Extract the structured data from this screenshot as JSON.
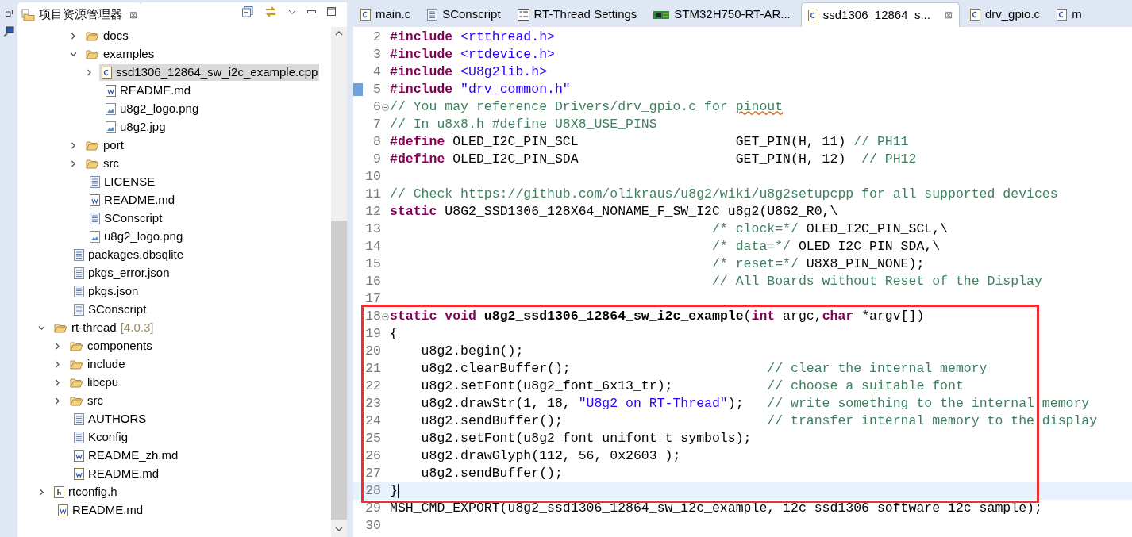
{
  "explorer": {
    "title": "项目资源管理器",
    "close": "⊠",
    "tree": [
      {
        "children": [
          {
            "children": [
              {
                "label": "docs",
                "kind": "folder",
                "expanded": false,
                "selected": false
              },
              {
                "label": "examples",
                "kind": "folder",
                "expanded": true,
                "selected": false,
                "children": [
                  {
                    "label": "ssd1306_12864_sw_i2c_example.cpp",
                    "kind": "c",
                    "expanded": false,
                    "selected": true
                  },
                  {
                    "label": "README.md",
                    "kind": "md",
                    "selected": false
                  },
                  {
                    "label": "u8g2_logo.png",
                    "kind": "image",
                    "selected": false
                  },
                  {
                    "label": "u8g2.jpg",
                    "kind": "image",
                    "selected": false
                  }
                ]
              },
              {
                "label": "port",
                "kind": "folder",
                "expanded": false,
                "selected": false
              },
              {
                "label": "src",
                "kind": "folder",
                "expanded": false,
                "selected": false
              },
              {
                "label": "LICENSE",
                "kind": "text",
                "selected": false
              },
              {
                "label": "README.md",
                "kind": "md",
                "selected": false
              },
              {
                "label": "SConscript",
                "kind": "text",
                "selected": false
              },
              {
                "label": "u8g2_logo.png",
                "kind": "image",
                "selected": false
              }
            ]
          },
          {
            "label": "packages.dbsqlite",
            "kind": "text",
            "selected": false
          },
          {
            "label": "pkgs_error.json",
            "kind": "text",
            "selected": false
          },
          {
            "label": "pkgs.json",
            "kind": "text",
            "selected": false
          },
          {
            "label": "SConscript",
            "kind": "text",
            "selected": false
          }
        ]
      },
      {
        "label": "rt-thread",
        "suffix": "[4.0.3]",
        "kind": "folder",
        "expanded": true,
        "selected": false,
        "children": [
          {
            "label": "components",
            "kind": "folder",
            "expanded": false,
            "selected": false
          },
          {
            "label": "include",
            "kind": "folder",
            "expanded": false,
            "selected": false
          },
          {
            "label": "libcpu",
            "kind": "folder",
            "expanded": false,
            "selected": false
          },
          {
            "label": "src",
            "kind": "folder",
            "expanded": false,
            "selected": false
          },
          {
            "label": "AUTHORS",
            "kind": "text",
            "selected": false
          },
          {
            "label": "Kconfig",
            "kind": "text",
            "selected": false
          },
          {
            "label": "README_zh.md",
            "kind": "md",
            "selected": false
          },
          {
            "label": "README.md",
            "kind": "md",
            "selected": false
          }
        ]
      },
      {
        "label": "rtconfig.h",
        "kind": "h",
        "expanded": false,
        "selected": false
      },
      {
        "label": "README.md",
        "kind": "md",
        "selected": false
      }
    ]
  },
  "editor": {
    "tabs": [
      {
        "label": "main.c",
        "kind": "c",
        "selected": false
      },
      {
        "label": "SConscript",
        "kind": "text",
        "selected": false
      },
      {
        "label": "RT-Thread Settings",
        "kind": "settings",
        "selected": false
      },
      {
        "label": "STM32H750-RT-AR...",
        "kind": "board",
        "selected": false
      },
      {
        "label": "ssd1306_12864_s...",
        "kind": "c",
        "selected": true,
        "close": "⊠"
      },
      {
        "label": "drv_gpio.c",
        "kind": "c",
        "selected": false
      },
      {
        "label": "m",
        "kind": "c",
        "selected": false
      }
    ],
    "blocks": [
      {
        "boxed": false,
        "lines": [
          {
            "n": "2",
            "fold": false,
            "marker": false,
            "current": false,
            "t": [
              {
                "kind": "kw",
                "text": "#include"
              },
              {
                "kind": "hdr",
                "text": " <rtthread.h>"
              }
            ]
          },
          {
            "n": "3",
            "fold": false,
            "marker": false,
            "current": false,
            "t": [
              {
                "kind": "kw",
                "text": "#include"
              },
              {
                "kind": "hdr",
                "text": " <rtdevice.h>"
              }
            ]
          },
          {
            "n": "4",
            "fold": false,
            "marker": false,
            "current": false,
            "t": [
              {
                "kind": "kw",
                "text": "#include"
              },
              {
                "kind": "hdr",
                "text": " <U8g2lib.h>"
              }
            ]
          },
          {
            "n": "5",
            "fold": false,
            "marker": true,
            "current": false,
            "t": [
              {
                "kind": "kw",
                "text": "#include"
              },
              {
                "kind": "hdr",
                "text": " \"drv_common.h\""
              }
            ]
          },
          {
            "n": "6",
            "fold": true,
            "marker": false,
            "current": false,
            "t": [
              {
                "kind": "cm",
                "text": "// You may reference Drivers/drv_gpio.c for "
              },
              {
                "kind": "cmw",
                "text": "pinout"
              }
            ]
          },
          {
            "n": "7",
            "fold": false,
            "marker": false,
            "current": false,
            "t": [
              {
                "kind": "cm",
                "text": "// In u8x8.h #define U8X8_USE_PINS"
              }
            ]
          },
          {
            "n": "8",
            "fold": false,
            "marker": false,
            "current": false,
            "t": [
              {
                "kind": "kw",
                "text": "#define"
              },
              {
                "kind": "p",
                "text": " OLED_I2C_PIN_SCL                    GET_PIN(H, 11) "
              },
              {
                "kind": "cm",
                "text": "// PH11"
              }
            ]
          },
          {
            "n": "9",
            "fold": false,
            "marker": false,
            "current": false,
            "t": [
              {
                "kind": "kw",
                "text": "#define"
              },
              {
                "kind": "p",
                "text": " OLED_I2C_PIN_SDA                    GET_PIN(H, 12)  "
              },
              {
                "kind": "cm",
                "text": "// PH12"
              }
            ]
          },
          {
            "n": "10",
            "fold": false,
            "marker": false,
            "current": false
          },
          {
            "n": "11",
            "fold": false,
            "marker": false,
            "current": false,
            "t": [
              {
                "kind": "cm",
                "text": "// Check https://github.com/olikraus/u8g2/wiki/u8g2setupcpp for all supported devices"
              }
            ]
          },
          {
            "n": "12",
            "fold": false,
            "marker": false,
            "current": false,
            "t": [
              {
                "kind": "kw",
                "text": "static"
              },
              {
                "kind": "p",
                "text": " U8G2_SSD1306_128X64_NONAME_F_SW_I2C u8g2(U8G2_R0,\\"
              }
            ]
          },
          {
            "n": "13",
            "fold": false,
            "marker": false,
            "current": false,
            "t": [
              {
                "kind": "cm",
                "text": "                                         /* clock=*/"
              },
              {
                "kind": "p",
                "text": " OLED_I2C_PIN_SCL,\\"
              }
            ]
          },
          {
            "n": "14",
            "fold": false,
            "marker": false,
            "current": false,
            "t": [
              {
                "kind": "cm",
                "text": "                                         /* data=*/"
              },
              {
                "kind": "p",
                "text": " OLED_I2C_PIN_SDA,\\"
              }
            ]
          },
          {
            "n": "15",
            "fold": false,
            "marker": false,
            "current": false,
            "t": [
              {
                "kind": "cm",
                "text": "                                         /* reset=*/"
              },
              {
                "kind": "p",
                "text": " U8X8_PIN_NONE);"
              }
            ]
          },
          {
            "n": "16",
            "fold": false,
            "marker": false,
            "current": false,
            "t": [
              {
                "kind": "cm",
                "text": "                                         // All Boards without Reset of the Display"
              }
            ]
          },
          {
            "n": "17",
            "fold": false,
            "marker": false,
            "current": false
          }
        ]
      },
      {
        "boxed": true,
        "lines": [
          {
            "n": "18",
            "fold": true,
            "marker": false,
            "current": false,
            "t": [
              {
                "kind": "kw",
                "text": "static"
              },
              {
                "kind": "kw",
                "text": " void"
              },
              {
                "kind": "fn",
                "text": " u8g2_ssd1306_12864_sw_i2c_example"
              },
              {
                "kind": "p",
                "text": "("
              },
              {
                "kind": "kw",
                "text": "int"
              },
              {
                "kind": "p",
                "text": " argc,"
              },
              {
                "kind": "kw",
                "text": "char"
              },
              {
                "kind": "p",
                "text": " *argv[])"
              }
            ]
          },
          {
            "n": "19",
            "fold": false,
            "marker": false,
            "current": false,
            "t": [
              {
                "kind": "p",
                "text": "{"
              }
            ]
          },
          {
            "n": "20",
            "fold": false,
            "marker": false,
            "current": false,
            "t": [
              {
                "kind": "p",
                "text": "    u8g2.begin();"
              }
            ]
          },
          {
            "n": "21",
            "fold": false,
            "marker": false,
            "current": false,
            "t": [
              {
                "kind": "p",
                "text": "    u8g2.clearBuffer();                         "
              },
              {
                "kind": "cm",
                "text": "// clear the internal memory"
              }
            ]
          },
          {
            "n": "22",
            "fold": false,
            "marker": false,
            "current": false,
            "t": [
              {
                "kind": "p",
                "text": "    u8g2.setFont(u8g2_font_6x13_tr);            "
              },
              {
                "kind": "cm",
                "text": "// choose a suitable font"
              }
            ]
          },
          {
            "n": "23",
            "fold": false,
            "marker": false,
            "current": false,
            "t": [
              {
                "kind": "p",
                "text": "    u8g2.drawStr(1, 18, "
              },
              {
                "kind": "str",
                "text": "\"U8g2 on RT-Thread\""
              },
              {
                "kind": "p",
                "text": ");   "
              },
              {
                "kind": "cm",
                "text": "// write something to the internal memory"
              }
            ]
          },
          {
            "n": "24",
            "fold": false,
            "marker": false,
            "current": false,
            "t": [
              {
                "kind": "p",
                "text": "    u8g2.sendBuffer();                          "
              },
              {
                "kind": "cm",
                "text": "// transfer internal memory to the display"
              }
            ]
          },
          {
            "n": "25",
            "fold": false,
            "marker": false,
            "current": false,
            "t": [
              {
                "kind": "p",
                "text": "    u8g2.setFont(u8g2_font_unifont_t_symbols);"
              }
            ]
          },
          {
            "n": "26",
            "fold": false,
            "marker": false,
            "current": false,
            "t": [
              {
                "kind": "p",
                "text": "    u8g2.drawGlyph(112, 56, 0x2603 );"
              }
            ]
          },
          {
            "n": "27",
            "fold": false,
            "marker": false,
            "current": false,
            "t": [
              {
                "kind": "p",
                "text": "    u8g2.sendBuffer();"
              }
            ]
          },
          {
            "n": "28",
            "fold": false,
            "marker": false,
            "current": true,
            "t": [
              {
                "kind": "p",
                "text": "}"
              }
            ]
          }
        ]
      },
      {
        "boxed": false,
        "lines": [
          {
            "n": "29",
            "fold": false,
            "marker": false,
            "current": false,
            "t": [
              {
                "kind": "p",
                "text": "MSH_CMD_EXPORT(u8g2_ssd1306_12864_sw_i2c_example, i2c ssd1306 software i2c sample);"
              }
            ]
          },
          {
            "n": "30",
            "fold": false,
            "marker": false,
            "current": false
          }
        ]
      }
    ]
  }
}
